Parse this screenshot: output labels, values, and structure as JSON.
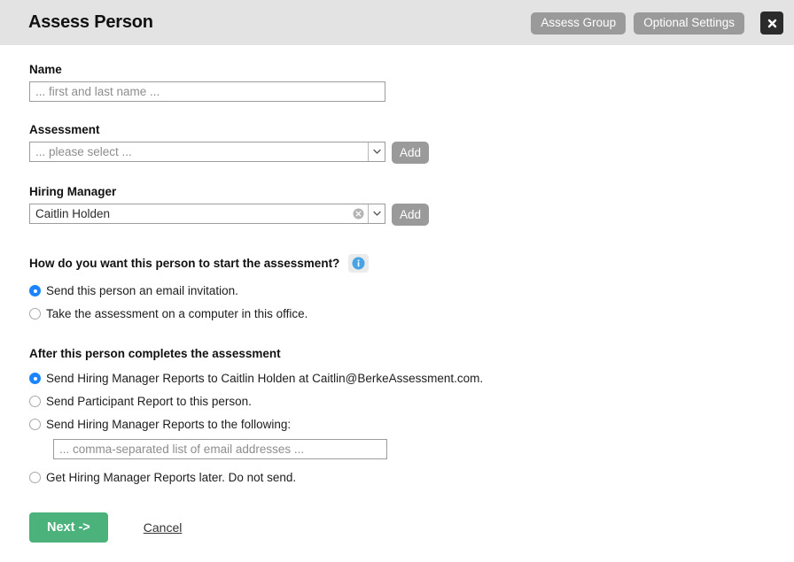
{
  "header": {
    "title": "Assess Person",
    "assess_group_label": "Assess Group",
    "optional_settings_label": "Optional Settings",
    "close_label": "x",
    "bg_color": "#e3e3e3",
    "button_color": "#9a9a9a",
    "close_color": "#2b2b2b"
  },
  "form": {
    "name": {
      "label": "Name",
      "placeholder": "... first and last name ...",
      "value": ""
    },
    "assessment": {
      "label": "Assessment",
      "placeholder": "... please select ...",
      "value": "",
      "add_label": "Add"
    },
    "hiring_manager": {
      "label": "Hiring Manager",
      "value": "Caitlin Holden",
      "add_label": "Add"
    }
  },
  "start_question": {
    "text": "How do you want this person to start the assessment?",
    "info_tooltip": "i",
    "options": [
      {
        "label": "Send this person an email invitation.",
        "selected": true
      },
      {
        "label": "Take the assessment on a computer in this office.",
        "selected": false
      }
    ]
  },
  "after_question": {
    "text": "After this person completes the assessment",
    "options": [
      {
        "label": "Send Hiring Manager Reports to Caitlin Holden at Caitlin@BerkeAssessment.com.",
        "selected": true
      },
      {
        "label": "Send Participant Report to this person.",
        "selected": false
      },
      {
        "label": "Send Hiring Manager Reports to the following:",
        "selected": false
      },
      {
        "label": "Get Hiring Manager Reports later. Do not send.",
        "selected": false
      }
    ],
    "email_list": {
      "placeholder": "... comma-separated list of email addresses ...",
      "value": ""
    }
  },
  "footer": {
    "next_label": "Next ->",
    "cancel_label": "Cancel",
    "next_color": "#4bb27b"
  }
}
